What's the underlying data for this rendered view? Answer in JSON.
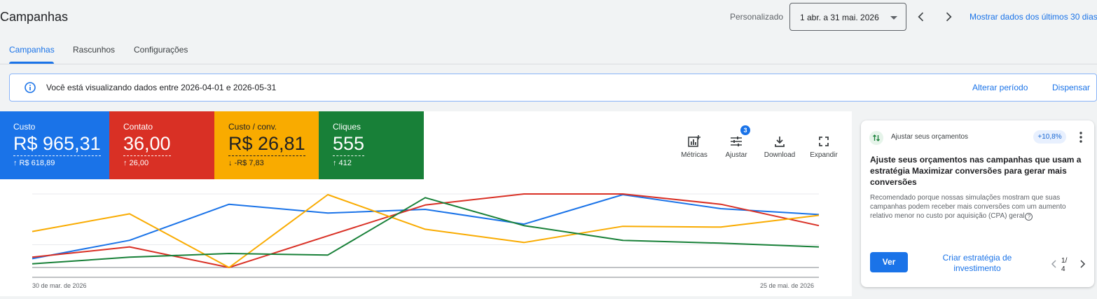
{
  "header": {
    "title": "Campanhas",
    "date_label": "Personalizado",
    "date_range": "1 abr. a 31 mai. 2026",
    "show_recent_link": "Mostrar dados dos últimos 30 dias"
  },
  "tabs": [
    {
      "label": "Campanhas",
      "active": true
    },
    {
      "label": "Rascunhos",
      "active": false
    },
    {
      "label": "Configurações",
      "active": false
    }
  ],
  "banner": {
    "text": "Você está visualizando dados entre 2026-04-01 e 2026-05-31",
    "change_period": "Alterar período",
    "dismiss": "Dispensar"
  },
  "metrics": [
    {
      "name": "Custo",
      "value": "R$ 965,31",
      "delta": "↑ R$ 618,89",
      "color": "#1a73e8"
    },
    {
      "name": "Contato",
      "value": "36,00",
      "delta": "↑ 26,00",
      "color": "#d93025"
    },
    {
      "name": "Custo / conv.",
      "value": "R$ 26,81",
      "delta": "↓ -R$ 7,83",
      "color": "#f9ab00"
    },
    {
      "name": "Cliques",
      "value": "555",
      "delta": "↑ 412",
      "color": "#188038"
    }
  ],
  "toolbar": {
    "metrics": "Métricas",
    "adjust": "Ajustar",
    "adjust_badge": "3",
    "download": "Download",
    "expand": "Expandir"
  },
  "chart_data": {
    "type": "line",
    "x_start_label": "30 de mar. de 2026",
    "x_end_label": "25 de mai. de 2026",
    "normalized": true,
    "series": [
      {
        "color": "#1a73e8",
        "values": [
          0.12,
          0.37,
          0.86,
          0.74,
          0.79,
          0.59,
          0.99,
          0.8,
          0.72
        ]
      },
      {
        "color": "#d93025",
        "values": [
          0.14,
          0.28,
          0.0,
          0.43,
          0.85,
          1.0,
          1.0,
          0.86,
          0.57
        ]
      },
      {
        "color": "#f9ab00",
        "values": [
          0.49,
          0.73,
          0.0,
          0.99,
          0.52,
          0.34,
          0.56,
          0.55,
          0.71
        ]
      },
      {
        "color": "#188038",
        "values": [
          0.05,
          0.14,
          0.19,
          0.17,
          0.95,
          0.57,
          0.37,
          0.33,
          0.28
        ]
      }
    ]
  },
  "recommendation": {
    "title": "Ajustar seus orçamentos",
    "pill": "+10,8%",
    "heading": "Ajuste seus orçamentos nas campanhas que usam a estratégia Maximizar conversões para gerar mais conversões",
    "body": "Recomendado porque nossas simulações mostram que suas campanhas podem receber mais conversões com um aumento relativo menor no custo por aquisição (CPA) geral",
    "apply_button": "Ver",
    "secondary_link": "Criar estratégia de investimento",
    "page_current": "1",
    "page_total": "4"
  }
}
